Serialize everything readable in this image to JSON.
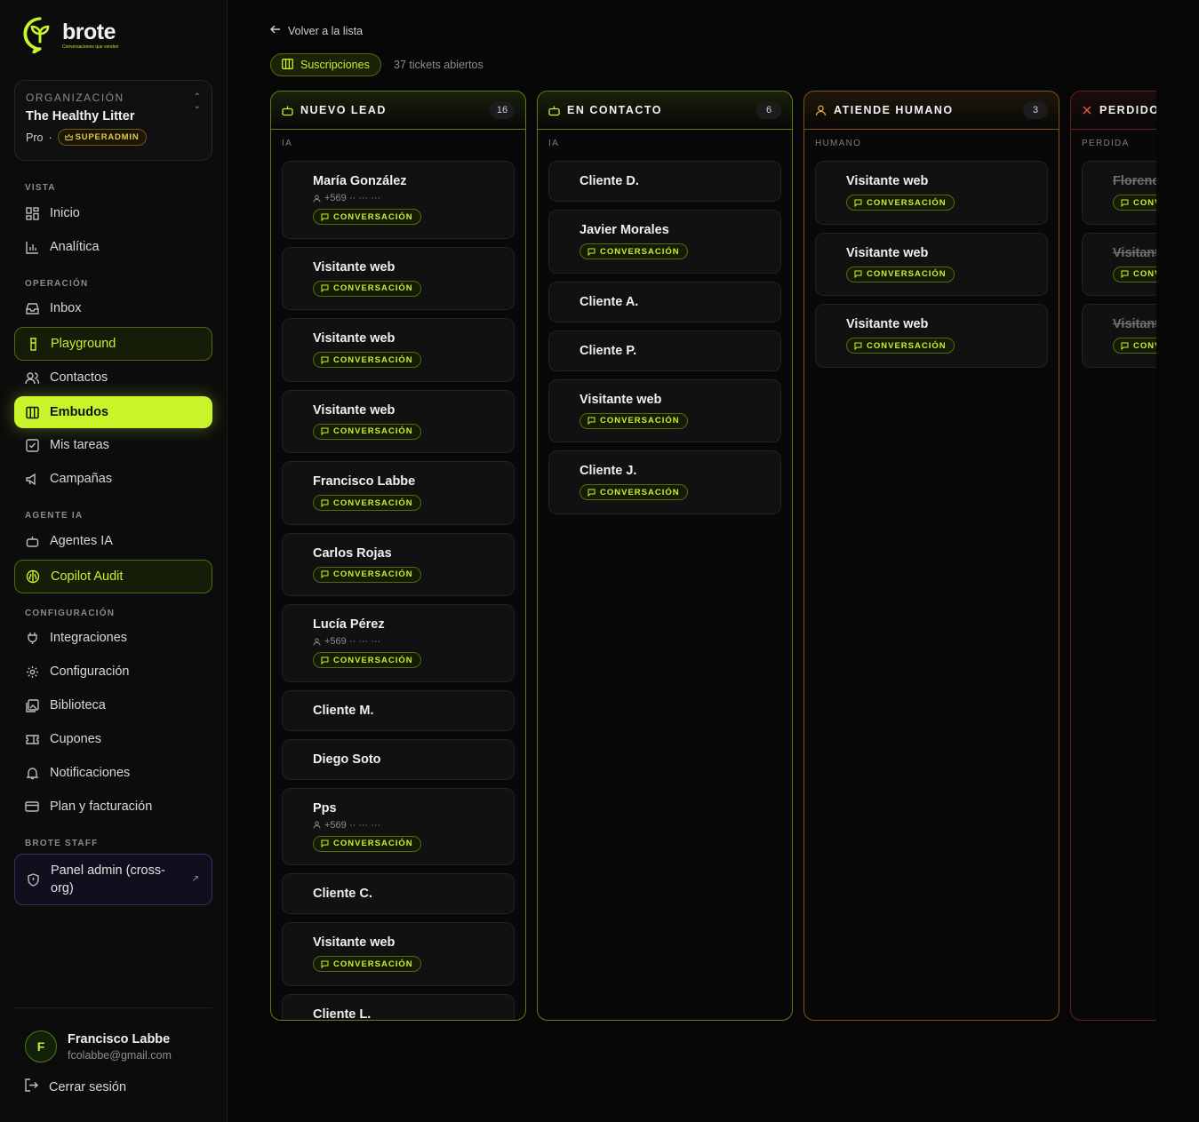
{
  "brand": {
    "name": "brote",
    "tagline": "Conversaciones que venden"
  },
  "org": {
    "label": "Organización",
    "name": "The Healthy Litter",
    "plan": "Pro",
    "separator": "·",
    "role_badge": "SUPERADMIN"
  },
  "nav": {
    "vista": "Vista",
    "inicio": "Inicio",
    "analitica": "Analítica",
    "operacion": "Operación",
    "inbox": "Inbox",
    "playground": "Playground",
    "contactos": "Contactos",
    "embudos": "Embudos",
    "mis_tareas": "Mis tareas",
    "campanas": "Campañas",
    "agente_ia": "Agente IA",
    "agentes_ia": "Agentes IA",
    "copilot_audit": "Copilot Audit",
    "configuracion_section": "Configuración",
    "integraciones": "Integraciones",
    "configuracion": "Configuración",
    "biblioteca": "Biblioteca",
    "cupones": "Cupones",
    "notificaciones": "Notificaciones",
    "plan_facturacion": "Plan y facturación",
    "brote_staff": "Brote staff",
    "panel_admin": "Panel admin (cross-org)"
  },
  "user": {
    "initial": "F",
    "name": "Francisco Labbe",
    "email": "fcolabbe@gmail.com",
    "logout": "Cerrar sesión"
  },
  "header": {
    "back": "Volver a la lista",
    "pipeline": "Suscripciones",
    "tickets": "37 tickets abiertos"
  },
  "conv_label": "CONVERSACIÓN",
  "columns": [
    {
      "title": "Nuevo lead",
      "count": "16",
      "subtitle": "IA",
      "icon": "bot-icon",
      "color": "#5b7f17",
      "cards": [
        {
          "name": "María González",
          "phone": "+569 ·· ··· ···",
          "conv": true
        },
        {
          "name": "Visitante web",
          "conv": true
        },
        {
          "name": "Visitante web",
          "conv": true
        },
        {
          "name": "Visitante web",
          "conv": true
        },
        {
          "name": "Francisco Labbe",
          "conv": true
        },
        {
          "name": "Carlos Rojas",
          "conv": true
        },
        {
          "name": "Lucía Pérez",
          "phone": "+569 ·· ··· ···",
          "conv": true
        },
        {
          "name": "Cliente M.",
          "conv": false
        },
        {
          "name": "Diego Soto",
          "conv": false
        },
        {
          "name": "Pps",
          "phone": "+569 ·· ··· ···",
          "conv": true
        },
        {
          "name": "Cliente C.",
          "conv": false
        },
        {
          "name": "Visitante web",
          "conv": true
        },
        {
          "name": "Cliente L.",
          "conv": false
        }
      ]
    },
    {
      "title": "En contacto",
      "count": "6",
      "subtitle": "IA",
      "icon": "bot-icon",
      "color": "#5b7f17",
      "cards": [
        {
          "name": "Cliente D.",
          "conv": false
        },
        {
          "name": "Javier Morales",
          "conv": true
        },
        {
          "name": "Cliente A.",
          "conv": false
        },
        {
          "name": "Cliente P.",
          "conv": false
        },
        {
          "name": "Visitante web",
          "conv": true
        },
        {
          "name": "Cliente J.",
          "conv": true
        }
      ]
    },
    {
      "title": "Atiende humano",
      "count": "3",
      "subtitle": "Humano",
      "icon": "person-icon",
      "color": "#7a5516",
      "cards": [
        {
          "name": "Visitante web",
          "conv": true
        },
        {
          "name": "Visitante web",
          "conv": true
        },
        {
          "name": "Visitante web",
          "conv": true
        }
      ]
    },
    {
      "title": "Perdido",
      "count": "",
      "subtitle": "Perdida",
      "icon": "x-icon",
      "color": "#6b1e1e",
      "cards": [
        {
          "name": "Florencia",
          "conv": true,
          "lost": true
        },
        {
          "name": "Visitante web",
          "conv": true,
          "lost": true
        },
        {
          "name": "Visitante web",
          "conv": true,
          "lost": true
        }
      ]
    }
  ]
}
